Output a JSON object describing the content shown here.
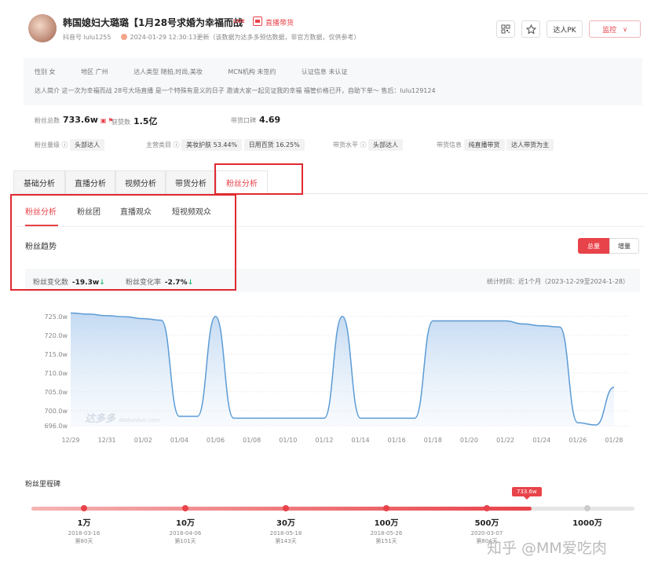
{
  "header": {
    "title": "韩国媳妇大璐璐【1月28号求婚为幸福而战",
    "live_badge": "LIVE",
    "live_label": "直播带货",
    "account": "抖音号 lulu1255",
    "updated": "2024-01-29 12:30:13更新（该数据为达多多预估数据，非官方数据，仅供参考）",
    "pk_label": "达人PK",
    "monitor_label": "监控"
  },
  "profile": {
    "row1": [
      "性别 女",
      "地区 广州",
      "达人类型 随拍,时尚,美妆",
      "MCN机构 未签约",
      "认证信息 未认证"
    ],
    "intro": "达人简介  这一次为幸福而战 28号大场直播 是一个特殊有意义的日子 邀请大家一起见证我的幸福 福管价格已开，自助下单～ 售后：lulu129124"
  },
  "metrics": {
    "fans_label": "粉丝总数",
    "fans_value": "733.6w",
    "likes_label": "获赞数",
    "likes_value": "1.5亿",
    "reputation_label": "带货口碑",
    "reputation_value": "4.69"
  },
  "tags": {
    "level_label": "粉丝量级",
    "level_value": "头部达人",
    "category_label": "主营类目",
    "cat1": "美妆护肤 53.44%",
    "cat2": "日用百货 16.25%",
    "sales_level_label": "带货水平",
    "sales_level_value": "头部达人",
    "sales_info_label": "带货信息",
    "sales_info1": "纯直播带货",
    "sales_info2": "达人带货为主"
  },
  "main_tabs": [
    "基础分析",
    "直播分析",
    "视频分析",
    "带货分析",
    "粉丝分析"
  ],
  "sub_tabs": [
    "粉丝分析",
    "粉丝团",
    "直播观众",
    "短视频观众"
  ],
  "trend": {
    "title": "粉丝趋势",
    "total_label": "总量",
    "inc_label": "增量",
    "change_count_label": "粉丝变化数",
    "change_count_value": "-19.3w",
    "change_rate_label": "粉丝变化率",
    "change_rate_value": "-2.7%",
    "stat_time": "统计时间：近1个月（2023-12-29至2024-1-28）",
    "watermark": "达多多",
    "watermark_sub": "daduoduo.com"
  },
  "chart_data": {
    "type": "area",
    "x": [
      "12/29",
      "12/30",
      "12/31",
      "01/01",
      "01/02",
      "01/03",
      "01/04",
      "01/05",
      "01/06",
      "01/07",
      "01/08",
      "01/09",
      "01/10",
      "01/11",
      "01/12",
      "01/13",
      "01/14",
      "01/15",
      "01/16",
      "01/17",
      "01/18",
      "01/19",
      "01/20",
      "01/21",
      "01/22",
      "01/23",
      "01/24",
      "01/25",
      "01/26",
      "01/27",
      "01/28"
    ],
    "tick_labels": [
      "12/29",
      "12/31",
      "01/02",
      "01/04",
      "01/06",
      "01/08",
      "01/10",
      "01/12",
      "01/14",
      "01/16",
      "01/18",
      "01/20",
      "01/22",
      "01/24",
      "01/26",
      "01/28"
    ],
    "values": [
      725.9,
      725.6,
      725.2,
      724.9,
      724.4,
      724.0,
      698.5,
      698.5,
      725.0,
      698.0,
      698.0,
      698.0,
      698.0,
      698.0,
      698.0,
      725.0,
      698.0,
      698.0,
      698.0,
      698.0,
      723.8,
      723.8,
      723.8,
      723.8,
      723.8,
      723.0,
      722.5,
      722.2,
      696.8,
      696.2,
      706.2
    ],
    "ylim": [
      696,
      726
    ],
    "yticks": [
      696.0,
      700.0,
      705.0,
      710.0,
      715.0,
      720.0,
      725.0
    ],
    "ytick_labels": [
      "696.0w",
      "700.0w",
      "705.0w",
      "710.0w",
      "715.0w",
      "720.0w",
      "725.0w"
    ],
    "color": "#5b9bd5"
  },
  "milestones": {
    "title": "粉丝里程碑",
    "current": "733.6w",
    "progress": 0.83,
    "items": [
      {
        "label": "1万",
        "date": "2018-03-16",
        "days": "第80天"
      },
      {
        "label": "10万",
        "date": "2018-04-06",
        "days": "第101天"
      },
      {
        "label": "30万",
        "date": "2018-05-18",
        "days": "第143天"
      },
      {
        "label": "100万",
        "date": "2018-05-26",
        "days": "第151天"
      },
      {
        "label": "500万",
        "date": "2020-03-07",
        "days": "第804天"
      },
      {
        "label": "1000万",
        "date": "",
        "days": ""
      }
    ]
  },
  "watermark": "知乎 @MM爱吃肉",
  "colors": {
    "accent": "#e8434a",
    "highlight_box": "#e02a2f",
    "down": "#2bb673"
  }
}
